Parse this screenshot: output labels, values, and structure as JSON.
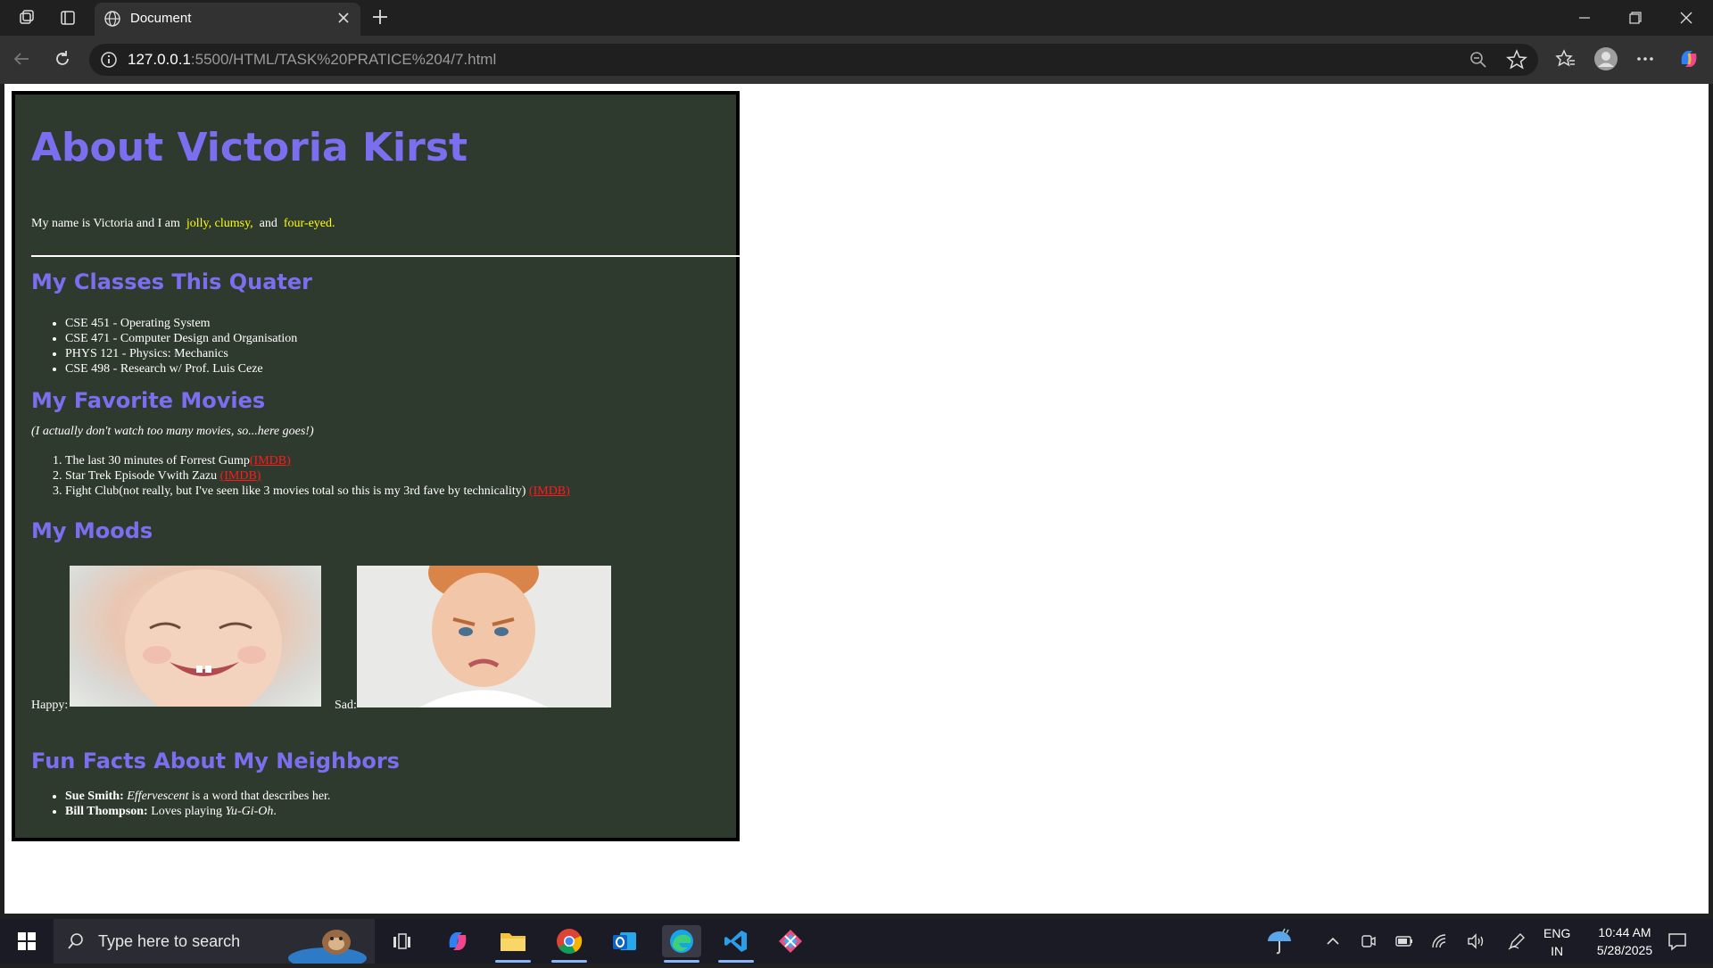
{
  "browser": {
    "tab_title": "Document",
    "url_host": "127.0.0.1",
    "url_path": ":5500/HTML/TASK%20PRATICE%204/7.html"
  },
  "page": {
    "heading": "About Victoria Kirst",
    "intro": {
      "prefix": "My name is Victoria and I am",
      "trait1": "jolly,",
      "trait2": "clumsy,",
      "and": "and",
      "trait3": "four-eyed."
    },
    "classes_heading": "My Classes This Quater",
    "classes": [
      "CSE 451 - Operating System",
      "CSE 471 - Computer Design and Organisation",
      "PHYS 121 - Physics: Mechanics",
      "CSE 498 - Research w/ Prof. Luis Ceze"
    ],
    "movies_heading": "My Favorite Movies",
    "movies_note": "(I actually don't watch too many movies, so...here goes!)",
    "movies": [
      {
        "text": "The last 30 minutes of Forrest Gump",
        "link": "(IMDB)"
      },
      {
        "text": "Star Trek Episode Vwith Zazu ",
        "link": "(IMDB)"
      },
      {
        "text": "Fight Club(not really, but I've seen like 3 movies total so this is my 3rd fave by technicality) ",
        "link": "(IMDB)"
      }
    ],
    "moods_heading": "My Moods",
    "moods": [
      {
        "label": "Happy:"
      },
      {
        "label": "Sad:"
      }
    ],
    "neighbors_heading": "Fun Facts About My Neighbors",
    "neighbors": [
      {
        "name": "Sue Smith:",
        "em": "Effervescent",
        "rest": " is a word that describes her."
      },
      {
        "name": "Bill Thompson:",
        "rest": " Loves playing ",
        "em": "Yu-Gi-Oh",
        "end": "."
      }
    ]
  },
  "taskbar": {
    "search_placeholder": "Type here to search",
    "lang_top": "ENG",
    "lang_bottom": "IN",
    "time": "10:44 AM",
    "date": "5/28/2025"
  },
  "colors": {
    "heading": "#7b6ff0",
    "page_bg": "#2f3a2f",
    "highlight": "#ffff00",
    "link": "#ff1a1a"
  }
}
